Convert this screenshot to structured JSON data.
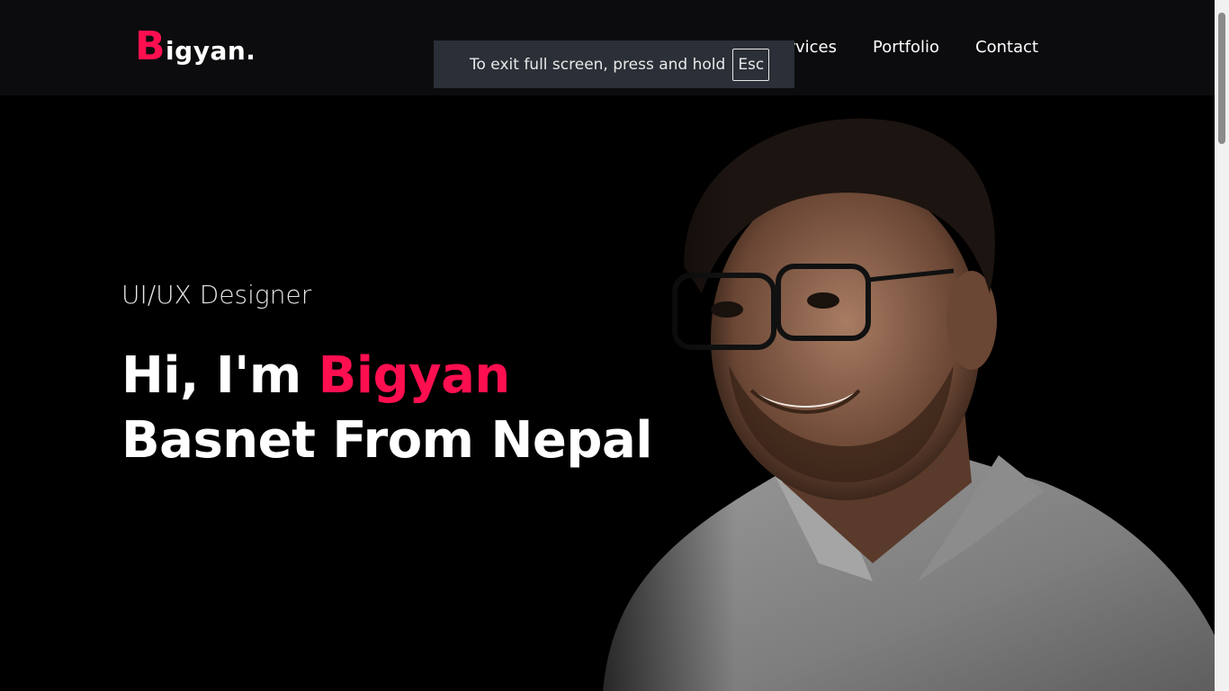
{
  "brand": {
    "logo_initial": "B",
    "logo_rest": "igyan."
  },
  "nav": {
    "services": "Services",
    "portfolio": "Portfolio",
    "contact": "Contact"
  },
  "toast": {
    "text": "To exit full screen, press and hold",
    "key": "Esc"
  },
  "hero": {
    "subtitle": "UI/UX Designer",
    "greeting": "Hi, I'm ",
    "name_accent": "Bigyan",
    "line2": "Basnet From Nepal"
  },
  "colors": {
    "accent": "#ff0f50",
    "background": "#000000",
    "navbar": "#0c0c0e"
  },
  "icons": {
    "photo": "portrait-photo"
  }
}
